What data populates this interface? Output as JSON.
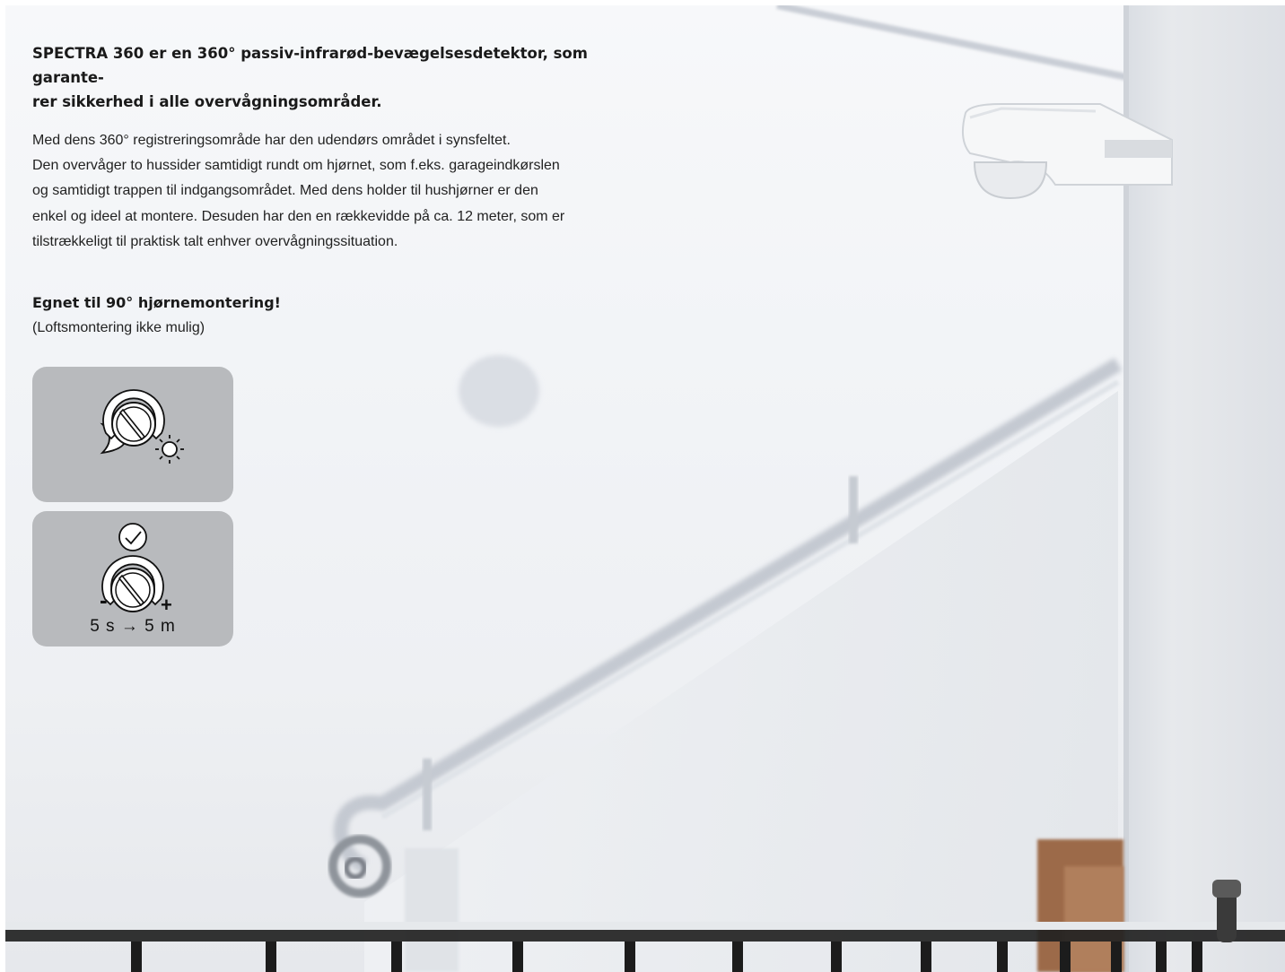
{
  "heading": "SPECTRA 360 er en 360° passiv-infrarød-bevægelsesdetektor, som garante­rer sikkerhed i alle overvågningsområder.",
  "heading_lines": [
    "SPECTRA 360 er en 360° passiv-infrarød-bevægelsesdetektor, som garante-",
    "rer sikkerhed i alle overvågningsområder."
  ],
  "body_lines": [
    "Med dens 360° registreringsområde har den udendørs området i synsfeltet.",
    "Den overvåger to hussider samtidigt rundt om hjørnet, som f.eks. garageindkørslen",
    "og samtidigt trappen til indgangsområdet. Med dens holder til hushjørner er den",
    "enkel og ideel at montere. Desuden har den en rækkevidde på ca. 12 meter, som er",
    "tilstrækkeligt til praktisk talt enhver overvågningssituation."
  ],
  "corner_title": "Egnet til 90° hjørnemontering!",
  "corner_note": "(Loftsmontering ikke mulig)",
  "light_panel": {
    "left_icon": "moon-icon",
    "dial_icon": "dial-icon",
    "right_icon": "sun-icon"
  },
  "time_panel": {
    "top_icon": "clock-icon",
    "dial_icon": "dial-icon",
    "minus": "-",
    "plus": "+",
    "range": "5 s → 5 m"
  },
  "colors": {
    "panel": "#b8babd",
    "text": "#1a1a1a",
    "wall": "#f2f4f7"
  }
}
